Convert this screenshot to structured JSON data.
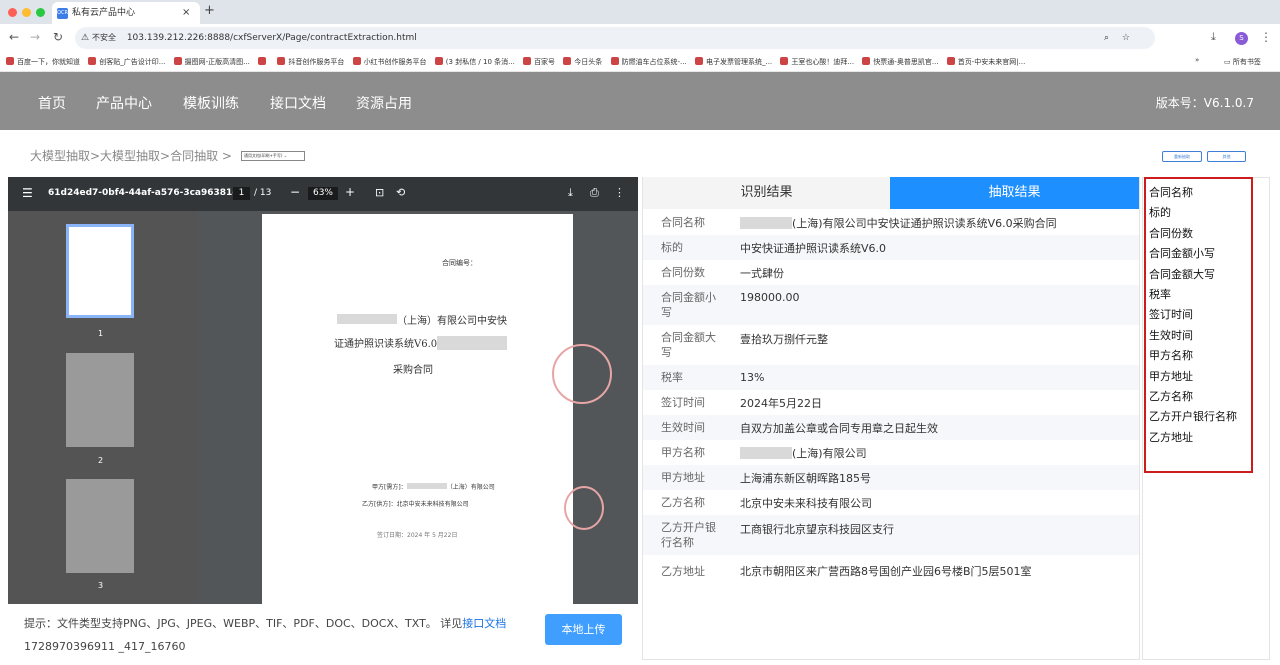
{
  "browser": {
    "tab_title": "私有云产品中心",
    "tab_icon": "OCR",
    "insecure_label": "不安全",
    "url": "103.139.212.226:8888/cxfServerX/Page/contractExtraction.html",
    "profile_letter": "S",
    "bookmarks": [
      "百度一下，你就知道",
      "创客贴_广告设计印...",
      "摄图网-正版高清图...",
      "",
      "抖音创作服务平台",
      "小红书创作服务平台",
      "(3 封私信 / 10 条消...",
      "百家号",
      "今日头条",
      "防燃油车占位系统-...",
      "电子发票管理系统_...",
      "王室也心酸！迪拜...",
      "快票通-奥普思凯官...",
      "首页-中安未来官网|..."
    ],
    "bookmarks_more": "»",
    "all_bookmarks": "所有书签"
  },
  "header": {
    "menu": [
      "首页",
      "产品中心",
      "模板训练",
      "接口文档",
      "资源占用"
    ],
    "version": "版本号：V6.1.0.7"
  },
  "breadcrumb": "大模型抽取>大模型抽取>合同抽取 >",
  "doc_type_select": "通用文档(印刷+手写)",
  "buttons": {
    "reextract": "重新抽取",
    "other": "其他"
  },
  "pdf": {
    "filename": "61d24ed7-0bf4-44af-a576-3ca96381d...",
    "page_current": "1",
    "page_total": "/ 13",
    "zoom": "63%",
    "thumb_numbers": [
      "1",
      "2",
      "3"
    ],
    "contract_no_label": "合同编号：",
    "title_line1": "（上海）有限公司中安快",
    "title_line2": "证通护照识读系统V6.0",
    "title_line3": "采购合同",
    "party_a": "甲方[需方]：",
    "party_a_suffix": "（上海）有限公司",
    "party_b": "乙方[供方]：北京中安未来科技有限公司",
    "sign_date": "签订日期：2024 年 5 月22日"
  },
  "hint": {
    "text": "提示：文件类型支持PNG、JPG、JPEG、WEBP、TIF、PDF、DOC、DOCX、TXT。 详见",
    "link": "接口文档",
    "code": "1728970396911 _417_16760"
  },
  "upload_button": "本地上传",
  "result_tabs": {
    "recognition": "识别结果",
    "extraction": "抽取结果"
  },
  "results": [
    {
      "key": "合同名称",
      "value": "(上海)有限公司中安快证通护照识读系统V6.0采购合同",
      "redacted": true
    },
    {
      "key": "标的",
      "value": "中安快证通护照识读系统V6.0"
    },
    {
      "key": "合同份数",
      "value": "一式肆份"
    },
    {
      "key": "合同金额小写",
      "value": "198000.00"
    },
    {
      "key": "合同金额大写",
      "value": "壹拾玖万捌仟元整"
    },
    {
      "key": "税率",
      "value": "13%"
    },
    {
      "key": "签订时间",
      "value": "2024年5月22日"
    },
    {
      "key": "生效时间",
      "value": "自双方加盖公章或合同专用章之日起生效"
    },
    {
      "key": "甲方名称",
      "value": "(上海)有限公司",
      "redacted": true
    },
    {
      "key": "甲方地址",
      "value": "上海浦东新区朝晖路185号"
    },
    {
      "key": "乙方名称",
      "value": "北京中安未来科技有限公司"
    },
    {
      "key": "乙方开户银行名称",
      "value": "工商银行北京望京科技园区支行"
    },
    {
      "key": "乙方地址",
      "value": "北京市朝阳区来广营西路8号国创产业园6号楼B门5层501室"
    }
  ],
  "field_list": [
    "合同名称",
    "标的",
    "合同份数",
    "合同金额小写",
    "合同金额大写",
    "税率",
    "签订时间",
    "生效时间",
    "甲方名称",
    "甲方地址",
    "乙方名称",
    "乙方开户银行名称",
    "乙方地址"
  ],
  "colors": {
    "accent": "#409eff",
    "header_bg": "#8d8d8d",
    "highlight_border": "#cc1c1c"
  }
}
